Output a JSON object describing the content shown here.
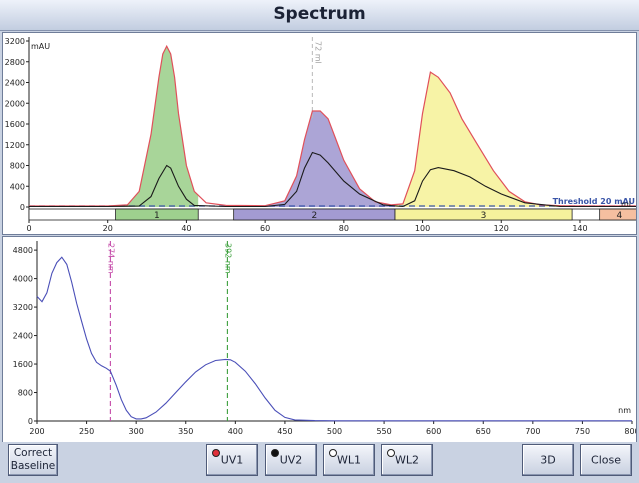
{
  "window": {
    "title": "Spectrum"
  },
  "chromatogram": {
    "y_unit": "mAU",
    "x_unit": "ml",
    "y_ticks": [
      "3200",
      "2800",
      "2400",
      "2000",
      "1600",
      "1200",
      "800",
      "400",
      "0"
    ],
    "x_ticks": [
      "0",
      "20",
      "40",
      "60",
      "80",
      "100",
      "120",
      "140"
    ],
    "cursor_label": "72 ml",
    "threshold_label": "Threshold 20 mAU",
    "fraction_labels": [
      "1",
      "2",
      "3",
      "4"
    ],
    "colors": {
      "fraction1": "#9ed08e",
      "fraction2": "#a39bd2",
      "fraction3": "#f6f29c",
      "fraction4": "#f5bfa0",
      "uv1": "#e0505a",
      "uv2": "#1a1a1a",
      "threshold": "#3a55a8"
    }
  },
  "spectrum": {
    "x_unit": "nm",
    "y_ticks": [
      "4800",
      "4000",
      "3200",
      "2400",
      "1600",
      "800",
      "0"
    ],
    "x_ticks": [
      "200",
      "250",
      "300",
      "350",
      "400",
      "450",
      "500",
      "550",
      "600",
      "650",
      "700",
      "750",
      "800"
    ],
    "marker1_label": "274 nm",
    "marker2_label": "392 nm",
    "colors": {
      "curve": "#4a4fb8",
      "marker1": "#c44aa8",
      "marker2": "#3ca03c"
    }
  },
  "buttons": {
    "correct_baseline": "Correct Baseline",
    "uv1": "UV1",
    "uv2": "UV2",
    "wl1": "WL1",
    "wl2": "WL2",
    "btn_3d": "3D",
    "close": "Close"
  },
  "chart_data": [
    {
      "type": "area",
      "y_unit": "mAU",
      "x_unit": "ml",
      "xlim": [
        0,
        155
      ],
      "ylim": [
        0,
        3200
      ],
      "series": [
        {
          "name": "UV1",
          "x": [
            0,
            20,
            25,
            28,
            31,
            33,
            34,
            35,
            36,
            37,
            38,
            40,
            42,
            45,
            50,
            60,
            65,
            68,
            70,
            72,
            74,
            76,
            78,
            80,
            84,
            88,
            92,
            95,
            98,
            100,
            102,
            104,
            107,
            110,
            114,
            118,
            122,
            126,
            130,
            135,
            140,
            145,
            150,
            155
          ],
          "values": [
            20,
            20,
            40,
            300,
            1400,
            2500,
            2950,
            3100,
            2950,
            2500,
            1800,
            800,
            300,
            80,
            30,
            25,
            120,
            600,
            1300,
            1850,
            1850,
            1700,
            1300,
            900,
            350,
            100,
            40,
            60,
            700,
            1800,
            2600,
            2500,
            2200,
            1700,
            1200,
            700,
            300,
            100,
            40,
            25,
            20,
            20,
            20,
            20
          ]
        },
        {
          "name": "UV2",
          "x": [
            0,
            20,
            28,
            31,
            33,
            35,
            36,
            38,
            40,
            42,
            50,
            60,
            65,
            68,
            70,
            72,
            74,
            76,
            80,
            84,
            90,
            95,
            98,
            100,
            102,
            104,
            108,
            112,
            116,
            120,
            126,
            135,
            140,
            155
          ],
          "values": [
            10,
            10,
            20,
            200,
            550,
            800,
            750,
            400,
            150,
            30,
            10,
            10,
            50,
            300,
            750,
            1050,
            1000,
            850,
            500,
            250,
            40,
            10,
            120,
            500,
            720,
            760,
            700,
            580,
            400,
            250,
            80,
            10,
            10,
            10
          ]
        }
      ],
      "threshold": 20,
      "fractions": [
        {
          "label": "1",
          "x_start": 22,
          "x_end": 43
        },
        {
          "label": "2",
          "x_start": 52,
          "x_end": 93
        },
        {
          "label": "3",
          "x_start": 93,
          "x_end": 138
        },
        {
          "label": "4",
          "x_start": 145,
          "x_end": 158
        }
      ],
      "cursor_x": 72
    },
    {
      "type": "line",
      "x_unit": "nm",
      "xlim": [
        200,
        800
      ],
      "ylim": [
        0,
        5000
      ],
      "series": [
        {
          "name": "spectrum",
          "x": [
            200,
            205,
            210,
            215,
            220,
            225,
            230,
            235,
            240,
            245,
            250,
            255,
            260,
            265,
            270,
            274,
            280,
            285,
            290,
            295,
            300,
            305,
            310,
            320,
            330,
            340,
            350,
            360,
            370,
            380,
            390,
            395,
            400,
            410,
            420,
            430,
            440,
            450,
            460,
            480,
            500,
            550,
            600,
            650,
            700,
            750,
            800
          ],
          "values": [
            3500,
            3350,
            3600,
            4150,
            4450,
            4600,
            4400,
            3900,
            3300,
            2800,
            2300,
            1900,
            1650,
            1550,
            1480,
            1400,
            1000,
            600,
            300,
            120,
            60,
            60,
            90,
            250,
            500,
            800,
            1100,
            1380,
            1580,
            1700,
            1730,
            1720,
            1650,
            1400,
            1050,
            650,
            300,
            100,
            30,
            10,
            5,
            5,
            5,
            5,
            5,
            5,
            5
          ]
        }
      ],
      "markers": [
        {
          "x": 274
        },
        {
          "x": 392
        }
      ]
    }
  ]
}
